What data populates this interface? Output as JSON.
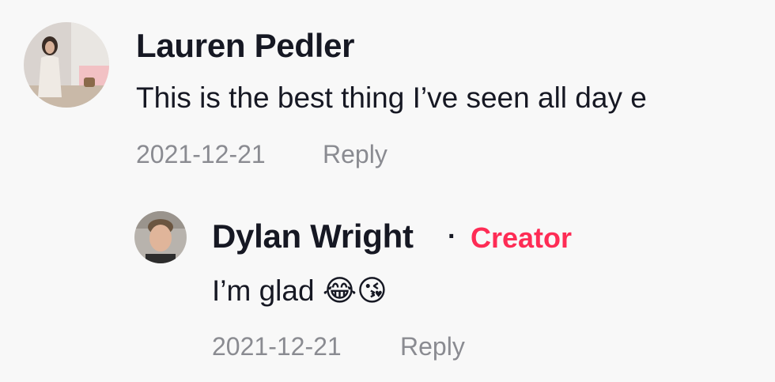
{
  "comments": [
    {
      "author": "Lauren Pedler",
      "text": "This is the best thing I’ve seen all day e",
      "date": "2021-12-21",
      "reply_label": "Reply"
    },
    {
      "author": "Dylan Wright",
      "separator": "·",
      "badge": "Creator",
      "text": "I’m glad 😂😘",
      "date": "2021-12-21",
      "reply_label": "Reply"
    }
  ],
  "colors": {
    "background": "#f8f8f8",
    "text": "#161823",
    "muted": "#8a8b91",
    "creator_badge": "#fe2c55"
  }
}
